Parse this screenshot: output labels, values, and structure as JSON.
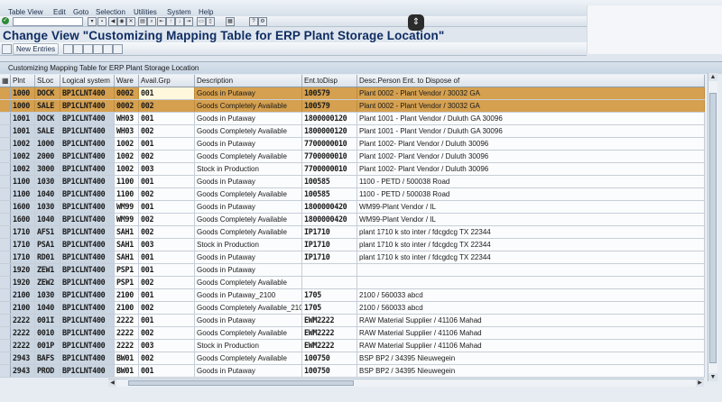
{
  "menu": [
    "Table View",
    "Edit",
    "Goto",
    "Selection",
    "Utilities",
    "System",
    "Help"
  ],
  "page_title": "Change View \"Customizing Mapping Table for ERP Plant Storage Location\"",
  "appbar": {
    "new_entries": "New Entries"
  },
  "panel": {
    "title": "Customizing Mapping Table for ERP Plant Storage Location"
  },
  "columns": [
    "Plnt",
    "SLoc",
    "Logical system",
    "Ware",
    "Avail.Grp",
    "Description",
    "Ent.toDisp",
    "Desc.Person Ent. to Dispose of"
  ],
  "rows": [
    [
      "1000",
      "DOCK",
      "BP1CLNT400",
      "0002",
      "001",
      "Goods in Putaway",
      "100579",
      "Plant 0002 - Plant Vendor / 30032 GA"
    ],
    [
      "1000",
      "SALE",
      "BP1CLNT400",
      "0002",
      "002",
      "Goods Completely Available",
      "100579",
      "Plant 0002 - Plant Vendor / 30032 GA"
    ],
    [
      "1001",
      "DOCK",
      "BP1CLNT400",
      "WH03",
      "001",
      "Goods in Putaway",
      "1800000120",
      "Plant 1001 - Plant Vendor / Duluth GA 30096"
    ],
    [
      "1001",
      "SALE",
      "BP1CLNT400",
      "WH03",
      "002",
      "Goods Completely Available",
      "1800000120",
      "Plant 1001 - Plant Vendor / Duluth GA 30096"
    ],
    [
      "1002",
      "1000",
      "BP1CLNT400",
      "1002",
      "001",
      "Goods in Putaway",
      "7700000010",
      "Plant 1002- Plant Vendor / Duluth 30096"
    ],
    [
      "1002",
      "2000",
      "BP1CLNT400",
      "1002",
      "002",
      "Goods Completely Available",
      "7700000010",
      "Plant 1002- Plant Vendor / Duluth 30096"
    ],
    [
      "1002",
      "3000",
      "BP1CLNT400",
      "1002",
      "003",
      "Stock in Production",
      "7700000010",
      "Plant 1002- Plant Vendor / Duluth 30096"
    ],
    [
      "1100",
      "1030",
      "BP1CLNT400",
      "1100",
      "001",
      "Goods in Putaway",
      "100585",
      "1100 - PETD / 500038 Road"
    ],
    [
      "1100",
      "1040",
      "BP1CLNT400",
      "1100",
      "002",
      "Goods Completely Available",
      "100585",
      "1100 - PETD / 500038 Road"
    ],
    [
      "1600",
      "1030",
      "BP1CLNT400",
      "WM99",
      "001",
      "Goods in Putaway",
      "1800000420",
      "WM99-Plant Vendor / IL"
    ],
    [
      "1600",
      "1040",
      "BP1CLNT400",
      "WM99",
      "002",
      "Goods Completely Available",
      "1800000420",
      "WM99-Plant Vendor / IL"
    ],
    [
      "1710",
      "AFS1",
      "BP1CLNT400",
      "SAH1",
      "002",
      "Goods Completely Available",
      "IP1710",
      "plant 1710 k sto inter / fdcgdcg TX 22344"
    ],
    [
      "1710",
      "PSA1",
      "BP1CLNT400",
      "SAH1",
      "003",
      "Stock in Production",
      "IP1710",
      "plant 1710 k sto inter / fdcgdcg TX 22344"
    ],
    [
      "1710",
      "RD01",
      "BP1CLNT400",
      "SAH1",
      "001",
      "Goods in Putaway",
      "IP1710",
      "plant 1710 k sto inter / fdcgdcg TX 22344"
    ],
    [
      "1920",
      "ZEW1",
      "BP1CLNT400",
      "PSP1",
      "001",
      "Goods in Putaway",
      "",
      ""
    ],
    [
      "1920",
      "ZEW2",
      "BP1CLNT400",
      "PSP1",
      "002",
      "Goods Completely Available",
      "",
      ""
    ],
    [
      "2100",
      "1030",
      "BP1CLNT400",
      "2100",
      "001",
      "Goods in Putaway_2100",
      "1705",
      "2100 / 560033 abcd"
    ],
    [
      "2100",
      "1040",
      "BP1CLNT400",
      "2100",
      "002",
      "Goods Completely Available_2100",
      "1705",
      "2100 / 560033 abcd"
    ],
    [
      "2222",
      "001I",
      "BP1CLNT400",
      "2222",
      "001",
      "Goods in Putaway",
      "EWM2222",
      "RAW Material Supplier / 41106 Mahad"
    ],
    [
      "2222",
      "0010",
      "BP1CLNT400",
      "2222",
      "002",
      "Goods Completely Available",
      "EWM2222",
      "RAW Material Supplier / 41106 Mahad"
    ],
    [
      "2222",
      "001P",
      "BP1CLNT400",
      "2222",
      "003",
      "Stock in Production",
      "EWM2222",
      "RAW Material Supplier / 41106 Mahad"
    ],
    [
      "2943",
      "BAFS",
      "BP1CLNT400",
      "BW01",
      "002",
      "Goods Completely Available",
      "100750",
      "BSP BP2 / 34395 Nieuwegein"
    ],
    [
      "2943",
      "PROD",
      "BP1CLNT400",
      "BW01",
      "001",
      "Goods in Putaway",
      "100750",
      "BSP BP2 / 34395 Nieuwegein"
    ]
  ],
  "highlight_rows": [
    0,
    1
  ],
  "colors": {
    "highlight": "#d5a04f",
    "title": "#0f2d63"
  }
}
